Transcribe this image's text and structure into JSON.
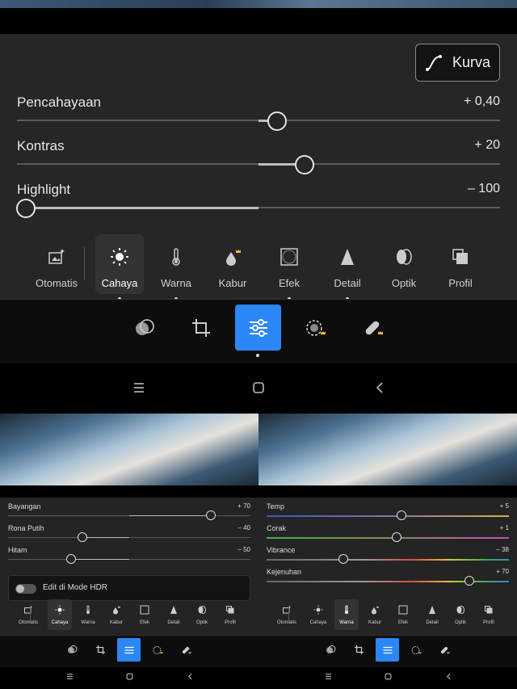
{
  "screen": {
    "curve_button": {
      "label": "Kurva",
      "icon": "curve-icon"
    },
    "sliders": [
      {
        "label": "Pencahayaan",
        "value": "+ 0,40",
        "position": 0.54
      },
      {
        "label": "Kontras",
        "value": "+ 20",
        "position": 0.6
      },
      {
        "label": "Highlight",
        "value": "– 100",
        "position": 0.0
      }
    ],
    "tabs": [
      {
        "label": "Otomatis",
        "icon": "auto-magic-icon"
      },
      {
        "label": "Cahaya",
        "icon": "sun-icon",
        "active": true
      },
      {
        "label": "Warna",
        "icon": "thermometer-icon"
      },
      {
        "label": "Kabur",
        "icon": "drop-premium-icon"
      },
      {
        "label": "Efek",
        "icon": "vignette-frame-icon"
      },
      {
        "label": "Detail",
        "icon": "triangle-icon"
      },
      {
        "label": "Optik",
        "icon": "lens-icon"
      },
      {
        "label": "Profil",
        "icon": "profile-stack-icon"
      }
    ],
    "tools": [
      "presets-icon",
      "crop-icon",
      "edit-sliders-icon",
      "masking-premium-icon",
      "heal-premium-icon"
    ],
    "nav": [
      "recent-apps-icon",
      "home-icon",
      "back-icon"
    ]
  },
  "mini_left": {
    "sliders": [
      {
        "label": "Bayangan",
        "value": "+ 70",
        "position": 0.85
      },
      {
        "label": "Rona Putih",
        "value": "– 40",
        "position": 0.3
      },
      {
        "label": "Hitam",
        "value": "– 50",
        "position": 0.26
      }
    ],
    "hdr_label": "Edit di Mode HDR",
    "active_tab": "Cahaya"
  },
  "mini_right": {
    "sliders": [
      {
        "label": "Temp",
        "value": "+ 5",
        "position": 0.56
      },
      {
        "label": "Corak",
        "value": "+ 1",
        "position": 0.54
      },
      {
        "label": "Vibrance",
        "value": "– 38",
        "position": 0.32
      },
      {
        "label": "Kejenuhan",
        "value": "+ 70",
        "position": 0.84
      }
    ],
    "active_tab": "Warna"
  },
  "mini_tabs": [
    "Otomatis",
    "Cahaya",
    "Warna",
    "Kabur",
    "Efek",
    "Detail",
    "Optik",
    "Profil"
  ],
  "colors": {
    "accent": "#2b87f5",
    "panel": "#262626",
    "premium": "#f2c53d"
  }
}
